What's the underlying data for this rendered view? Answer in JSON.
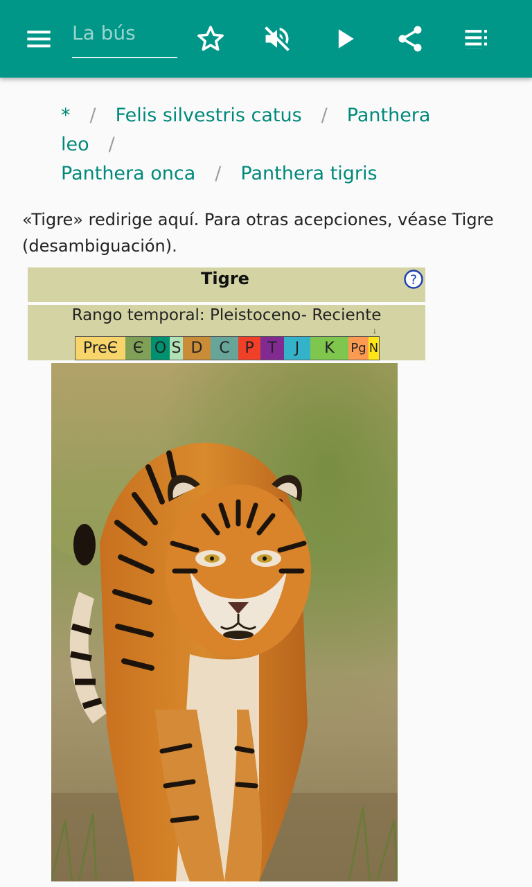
{
  "toolbar": {
    "search_placeholder": "La bús",
    "menu_icon": "menu-icon",
    "favorite_icon": "star-outline-icon",
    "sound_icon": "volume-off-icon",
    "play_icon": "play-icon",
    "share_icon": "share-icon",
    "list_icon": "playlist-icon"
  },
  "breadcrumb": {
    "items": [
      "*",
      "Felis silvestris catus",
      "Panthera leo",
      "Panthera onca",
      "Panthera tigris"
    ],
    "separator": "/"
  },
  "hatnote": "«Tigre» redirige aquí. Para otras acepciones, véase Tigre (desambiguación).",
  "taxobox": {
    "title": "Tigre",
    "range_label": "Rango temporal: Pleistoceno- Reciente",
    "arrow": "↓",
    "periods": [
      {
        "label": "PreЄ",
        "color": "#f7d56b"
      },
      {
        "label": "Є",
        "color": "#7fa056"
      },
      {
        "label": "O",
        "color": "#009270"
      },
      {
        "label": "S",
        "color": "#b3e1b6"
      },
      {
        "label": "D",
        "color": "#cb8c37"
      },
      {
        "label": "C",
        "color": "#67a599"
      },
      {
        "label": "P",
        "color": "#f04028"
      },
      {
        "label": "T",
        "color": "#812b92"
      },
      {
        "label": "J",
        "color": "#34b2c9"
      },
      {
        "label": "K",
        "color": "#7fc64e"
      },
      {
        "label": "Pg",
        "color": "#fd9a52"
      },
      {
        "label": "N",
        "color": "#ffe619"
      }
    ]
  },
  "image": {
    "alt": "tiger"
  },
  "colors": {
    "appbar": "#009688",
    "link": "#00897b",
    "taxobox": "#d3d3a4"
  }
}
